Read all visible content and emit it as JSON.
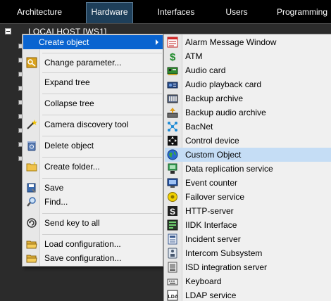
{
  "tabs": [
    {
      "label": "Architecture",
      "active": false
    },
    {
      "label": "Hardware",
      "active": true
    },
    {
      "label": "Interfaces",
      "active": false
    },
    {
      "label": "Users",
      "active": false
    },
    {
      "label": "Programming",
      "active": false
    }
  ],
  "tree": {
    "root_label": "LOCALHOST [WS1]"
  },
  "context_menu": {
    "items": [
      {
        "label": "Create object",
        "icon": "none",
        "submenu": true,
        "highlighted": true
      },
      {
        "label": "Change parameter...",
        "icon": "key-icon"
      },
      {
        "label": "Expand tree",
        "icon": "none"
      },
      {
        "label": "Collapse tree",
        "icon": "none"
      },
      {
        "label": "Camera discovery tool",
        "icon": "magic-wand-icon"
      },
      {
        "label": "Delete object",
        "icon": "recycle-bin-icon"
      },
      {
        "label": "Create folder...",
        "icon": "folder-icon"
      },
      {
        "label": "Save",
        "icon": "save-icon"
      },
      {
        "label": "Find...",
        "icon": "magnifier-icon"
      },
      {
        "label": "Send key to all",
        "icon": "send-key-icon"
      },
      {
        "label": "Load configuration...",
        "icon": "folder-open-icon"
      },
      {
        "label": "Save configuration...",
        "icon": "folder-save-icon"
      }
    ]
  },
  "submenu": {
    "items": [
      {
        "label": "Alarm Message Window",
        "icon": "alarm-window-icon"
      },
      {
        "label": "ATM",
        "icon": "dollar-icon"
      },
      {
        "label": "Audio card",
        "icon": "audio-card-icon"
      },
      {
        "label": "Audio playback card",
        "icon": "audio-playback-icon"
      },
      {
        "label": "Backup archive",
        "icon": "backup-archive-icon"
      },
      {
        "label": "Backup audio archive",
        "icon": "backup-audio-icon"
      },
      {
        "label": "BacNet",
        "icon": "bacnet-icon"
      },
      {
        "label": "Control device",
        "icon": "control-device-icon"
      },
      {
        "label": "Custom Object",
        "icon": "globe-icon",
        "highlighted": true
      },
      {
        "label": "Data replication service",
        "icon": "data-replication-icon"
      },
      {
        "label": "Event counter",
        "icon": "event-counter-icon"
      },
      {
        "label": "Failover service",
        "icon": "failover-icon"
      },
      {
        "label": "HTTP-server",
        "icon": "http-server-icon"
      },
      {
        "label": "IIDK Interface",
        "icon": "iidk-icon"
      },
      {
        "label": "Incident server",
        "icon": "incident-server-icon"
      },
      {
        "label": "Intercom Subsystem",
        "icon": "intercom-icon"
      },
      {
        "label": "ISD integration server",
        "icon": "isd-icon"
      },
      {
        "label": "Keyboard",
        "icon": "keyboard-icon"
      },
      {
        "label": "LDAP service",
        "icon": "ldap-icon"
      }
    ]
  },
  "colors": {
    "menu_highlight": "#0a64d0",
    "submenu_highlight": "#c5ddf5",
    "active_tab": "#1e3f5a"
  }
}
